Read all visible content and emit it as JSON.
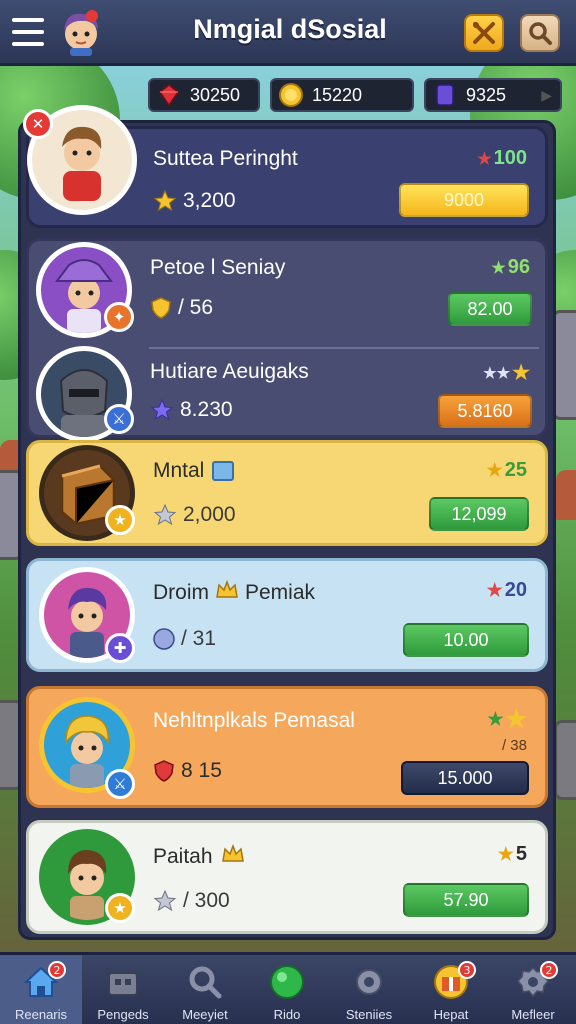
{
  "header": {
    "title": "Nmgial dSosial"
  },
  "currency": [
    {
      "icon": "ruby-gem-icon",
      "value": "30250"
    },
    {
      "icon": "gold-coin-icon",
      "value": "15220"
    },
    {
      "icon": "purple-gem-icon",
      "value": "9325"
    }
  ],
  "leaderboard": [
    {
      "name": "Suttea Peringht",
      "score": "3,200",
      "score_icon": "star-icon",
      "rank": "100",
      "rank_icon": "red-star-icon",
      "button": "9000",
      "button_color": "yellow",
      "card_color": "#3a4170",
      "name_color": "#ffffff"
    },
    {
      "name": "Petoe l Seniay",
      "score": "/ 56",
      "score_icon": "gold-shield-icon",
      "rank": "96",
      "rank_icon": "green-star-icon",
      "button": "82.00",
      "button_color": "green",
      "card_color": "#4a4d72",
      "name_color": "#ffffff"
    },
    {
      "name": "Hutiare Aeuigaks",
      "score": "8.230",
      "score_icon": "purple-star-icon",
      "rank": "",
      "rank_icon": "three-stars-icon",
      "button": "5.8160",
      "button_color": "orange",
      "card_color": "#4a4d72",
      "name_color": "#ffffff"
    },
    {
      "name": "Mntal",
      "score": "2,000",
      "score_icon": "silver-star-icon",
      "rank": "25",
      "rank_icon": "gold-star-icon",
      "button": "12,099",
      "button_color": "green",
      "card_color": "#f7d774",
      "name_color": "#2c2c2c"
    },
    {
      "name": "Droim",
      "name2": "Pemiak",
      "score": "/ 31",
      "score_icon": "blue-shield-icon",
      "rank": "20",
      "rank_icon": "red-star-icon",
      "button": "10.00",
      "button_color": "green",
      "card_color": "#c7e3f3",
      "name_color": "#2c2c2c"
    },
    {
      "name": "Nehltnplkals Pemasal",
      "score": "8 15",
      "score_icon": "red-shield-icon",
      "rank": "/ 38",
      "rank_icon": "green-gold-stars-icon",
      "button": "15.000",
      "button_color": "navy",
      "card_color": "#f5a85c",
      "name_color": "#ffffff"
    },
    {
      "name": "Paitah",
      "score": "/ 300",
      "score_icon": "silver-star-icon",
      "rank": "5",
      "rank_icon": "gold-star-icon",
      "button": "57.90",
      "button_color": "green",
      "card_color": "#f2f5ef",
      "name_color": "#2c2c2c"
    }
  ],
  "nav": [
    {
      "label": "Reenaris",
      "icon": "home-icon",
      "badge": "2",
      "active": true
    },
    {
      "label": "Pengeds",
      "icon": "shop-icon",
      "badge": "",
      "active": false
    },
    {
      "label": "Meeyiet",
      "icon": "search-icon",
      "badge": "",
      "active": false
    },
    {
      "label": "Rido",
      "icon": "green-orb-icon",
      "badge": "",
      "active": false
    },
    {
      "label": "Steniies",
      "icon": "gear-icon",
      "badge": "",
      "active": false
    },
    {
      "label": "Hepat",
      "icon": "gift-icon",
      "badge": "3",
      "active": false
    },
    {
      "label": "Mefleer",
      "icon": "settings-icon",
      "badge": "2",
      "active": false
    }
  ]
}
